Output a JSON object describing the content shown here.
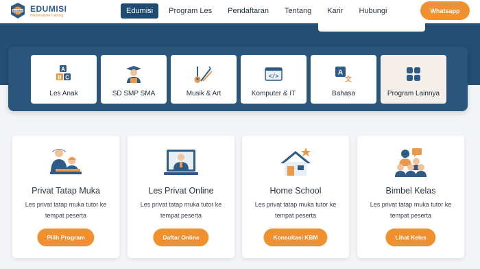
{
  "brand": {
    "name": "EDUMISI",
    "tagline": "Personalized Tutoring"
  },
  "nav": {
    "items": [
      {
        "label": "Edumisi",
        "active": true
      },
      {
        "label": "Program Les",
        "active": false
      },
      {
        "label": "Pendaftaran",
        "active": false
      },
      {
        "label": "Tentang",
        "active": false
      },
      {
        "label": "Karir",
        "active": false
      },
      {
        "label": "Hubungi",
        "active": false
      }
    ],
    "cta_label": "Whatsapp"
  },
  "categories": [
    {
      "label": "Les Anak",
      "icon": "abc-blocks-icon"
    },
    {
      "label": "SD SMP SMA",
      "icon": "student-icon"
    },
    {
      "label": "Musik & Art",
      "icon": "guitar-brush-icon"
    },
    {
      "label": "Komputer & IT",
      "icon": "code-window-icon"
    },
    {
      "label": "Bahasa",
      "icon": "translate-icon"
    },
    {
      "label": "Program Lainnya",
      "icon": "grid-icon"
    }
  ],
  "services": [
    {
      "title": "Privat Tatap Muka",
      "desc": "Les privat tatap muka tutor ke tempat peserta",
      "button": "Pilih Program",
      "icon": "tutor-student-icon"
    },
    {
      "title": "Les Privat Online",
      "desc": "Les privat tatap muka tutor ke tempat peserta",
      "button": "Daftar Online",
      "icon": "online-tutor-icon"
    },
    {
      "title": "Home School",
      "desc": "Les privat tatap muka tutor ke tempat peserta",
      "button": "Konsultasi KBM",
      "icon": "home-school-icon"
    },
    {
      "title": "Bimbel Kelas",
      "desc": "Les privat tatap muka tutor ke tempat peserta",
      "button": "Lihat Kelas",
      "icon": "group-class-icon"
    }
  ],
  "colors": {
    "primary": "#244e74",
    "accent": "#f0902e",
    "background": "#f3f4f7"
  }
}
